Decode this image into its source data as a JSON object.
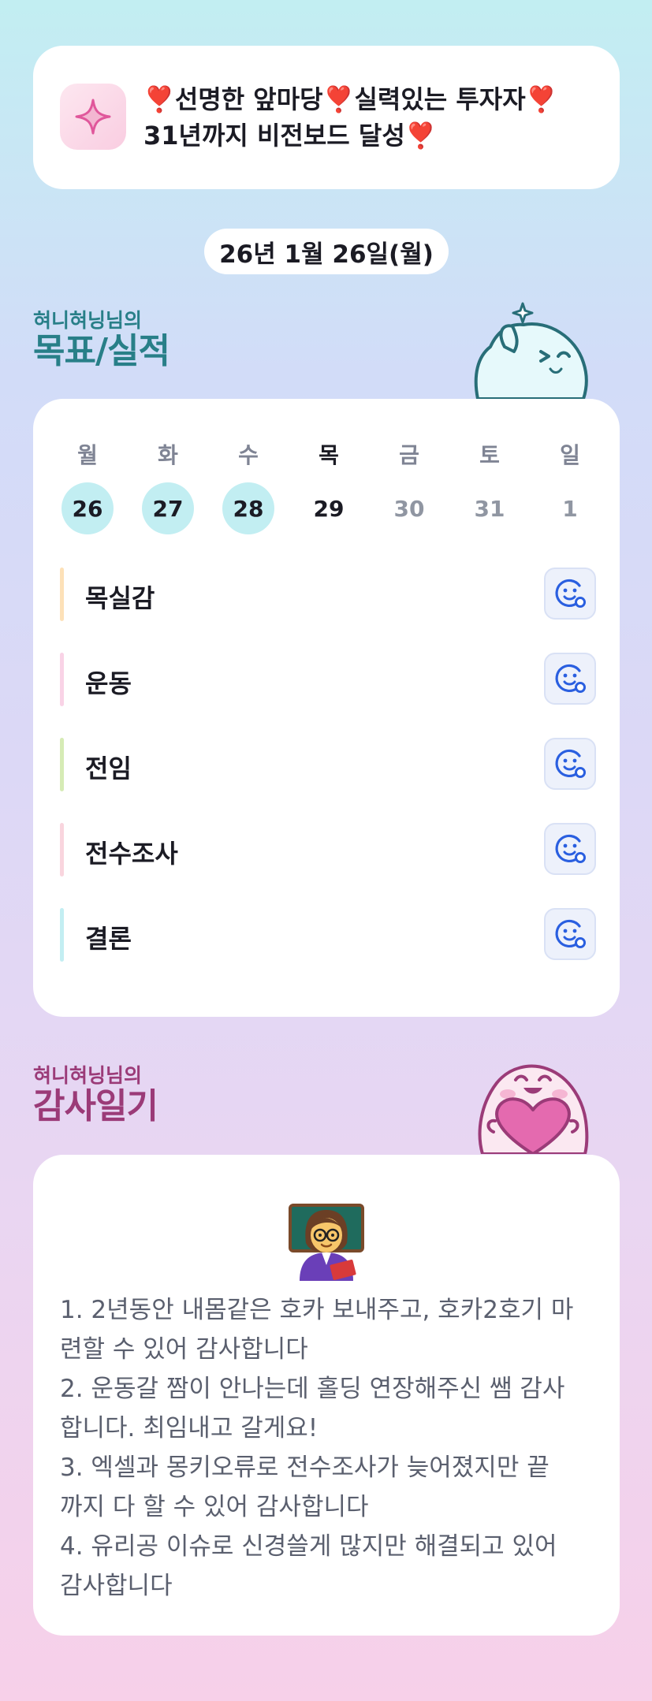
{
  "vision": {
    "icon": "sparkle-icon",
    "line1": "❣️선명한 앞마당❣️실력있는 투자자❣️",
    "line2": "31년까지 비전보드 달성❣️"
  },
  "date": "26년 1월 26일(월)",
  "goals_section": {
    "owner": "혀니혀닝님의",
    "title": "목표/실적",
    "days": [
      {
        "name": "월",
        "num": "26",
        "status": "done"
      },
      {
        "name": "화",
        "num": "27",
        "status": "done"
      },
      {
        "name": "수",
        "num": "28",
        "status": "done"
      },
      {
        "name": "목",
        "num": "29",
        "status": "today"
      },
      {
        "name": "금",
        "num": "30",
        "status": "future"
      },
      {
        "name": "토",
        "num": "31",
        "status": "future"
      },
      {
        "name": "일",
        "num": "1",
        "status": "future"
      }
    ],
    "goals": [
      {
        "label": "목실감",
        "color": "#fde1b8",
        "icon": "smile-check-icon"
      },
      {
        "label": "운동",
        "color": "#f9d3e6",
        "icon": "smile-check-icon"
      },
      {
        "label": "전임",
        "color": "#d6ebb5",
        "icon": "smile-check-icon"
      },
      {
        "label": "전수조사",
        "color": "#f9d5de",
        "icon": "smile-check-icon"
      },
      {
        "label": "결론",
        "color": "#c3eef2",
        "icon": "smile-check-icon"
      }
    ]
  },
  "diary_section": {
    "owner": "혀니혀닝님의",
    "title": "감사일기",
    "emoji": "teacher-emoji",
    "lines": [
      "1. 2년동안 내몸같은 호카 보내주고, 호카2호기 마",
      "련할 수 있어 감사합니다",
      "2. 운동갈 짬이 안나는데 홀딩 연장해주신 쌤 감사",
      "합니다. 최임내고 갈게요!",
      "3. 엑셀과 몽키오류로 전수조사가 늦어졌지만 끝",
      "까지 다 할 수 있어 감사합니다",
      "4. 유리공 이슈로 신경쓸게 많지만 해결되고 있어",
      "감사합니다"
    ]
  }
}
